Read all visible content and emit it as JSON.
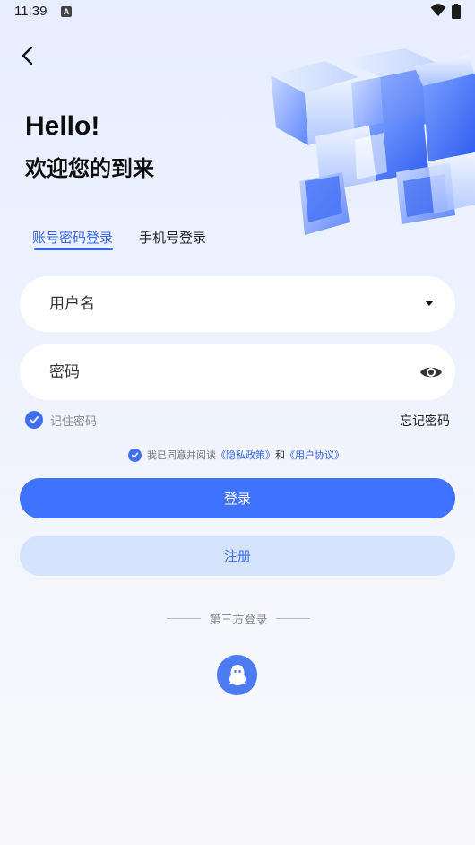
{
  "status_bar": {
    "time": "11:39",
    "notification_icon": "a-icon",
    "wifi_icon": "wifi-icon",
    "battery_icon": "battery-icon"
  },
  "nav": {
    "back_icon": "back-arrow-icon"
  },
  "hero": {
    "title": "Hello!",
    "subtitle": "欢迎您的到来",
    "art_icon": "glass-cubes-illustration"
  },
  "tabs": [
    {
      "label": "账号密码登录",
      "active": true
    },
    {
      "label": "手机号登录",
      "active": false
    }
  ],
  "form": {
    "username_placeholder": "用户名",
    "password_placeholder": "密码",
    "remember_label": "记住密码",
    "remember_checked": true,
    "forgot_label": "忘记密码"
  },
  "agreement": {
    "checked": true,
    "prefix": "我已同意并阅读",
    "privacy_link": "《隐私政策》",
    "and_text": "和",
    "terms_link": "《用户协议》"
  },
  "buttons": {
    "login": "登录",
    "register": "注册"
  },
  "third_party": {
    "label": "第三方登录",
    "provider_icon": "qq-penguin-icon"
  },
  "colors": {
    "primary": "#3f72ff",
    "primary_text": "#3666e6",
    "register_bg": "#d5e3fd",
    "background_top": "#e7eeff"
  }
}
